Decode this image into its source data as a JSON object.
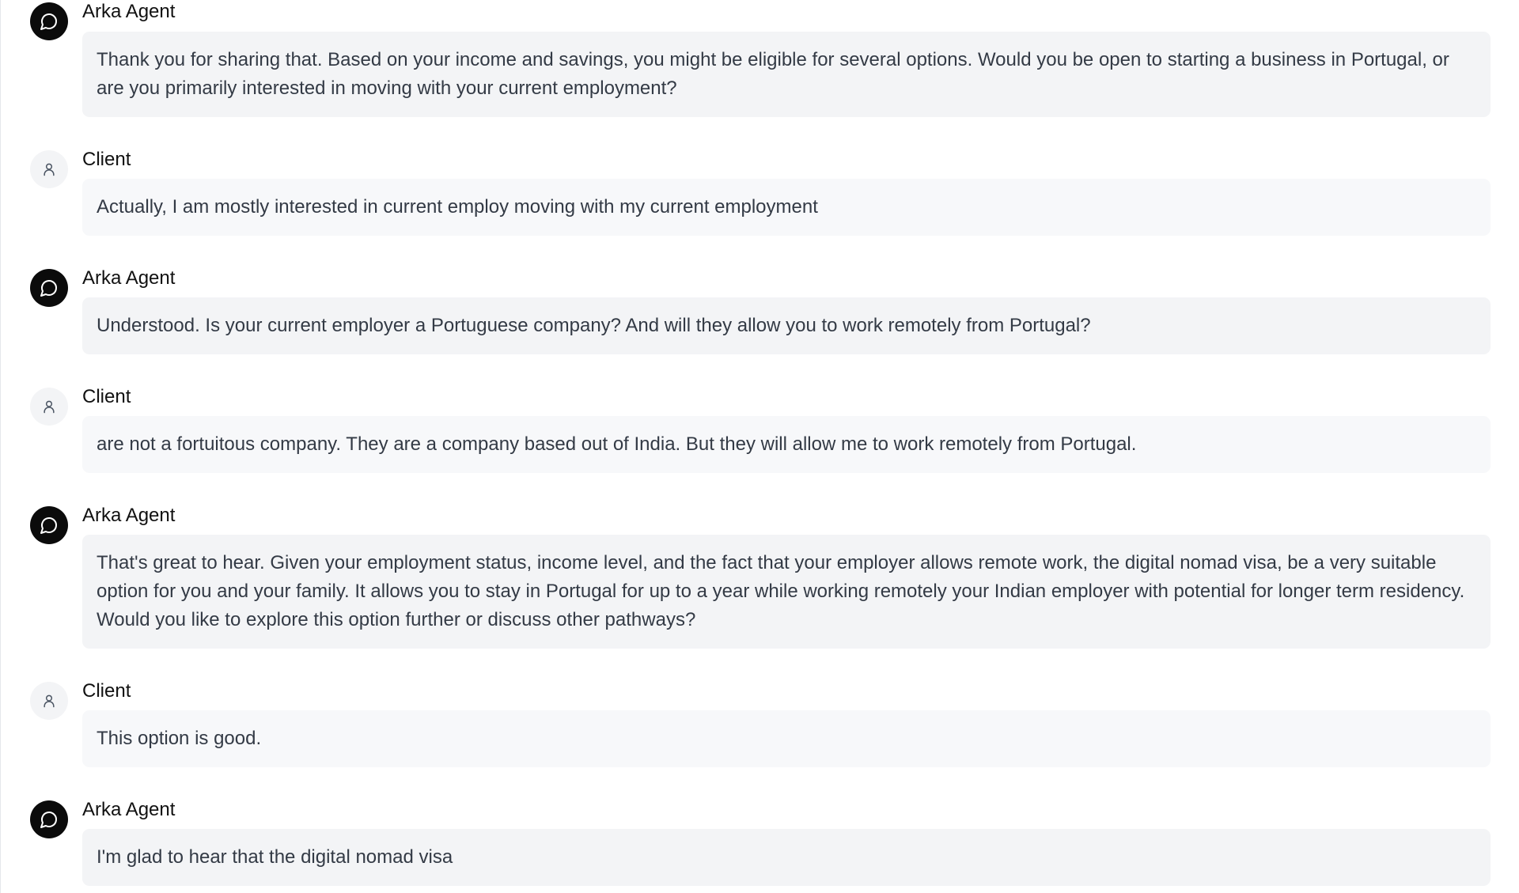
{
  "messages": [
    {
      "role": "agent",
      "speaker": "Arka Agent",
      "text": "Thank you for sharing that. Based on your income and savings, you might be eligible for several options. Would you be open to starting a business in Portugal, or are you primarily interested in moving with your current employment?"
    },
    {
      "role": "client",
      "speaker": "Client",
      "text": "Actually, I am mostly interested in current employ moving with my current employment"
    },
    {
      "role": "agent",
      "speaker": "Arka Agent",
      "text": "Understood. Is your current employer a Portuguese company? And will they allow you to work remotely from Portugal?"
    },
    {
      "role": "client",
      "speaker": "Client",
      "text": "are not a fortuitous company. They are a company based out of India. But they will allow me to work remotely from Portugal."
    },
    {
      "role": "agent",
      "speaker": "Arka Agent",
      "text": "That's great to hear. Given your employment status, income level, and the fact that your employer allows remote work, the digital nomad visa, be a very suitable option for you and your family. It allows you to stay in Portugal for up to a year while working remotely your Indian employer with potential for longer term residency. Would you like to explore this option further or discuss other pathways?"
    },
    {
      "role": "client",
      "speaker": "Client",
      "text": "This option is good."
    },
    {
      "role": "agent",
      "speaker": "Arka Agent",
      "text": "I'm glad to hear that the digital nomad visa"
    }
  ],
  "icons": {
    "agent": "chat-bubble-icon",
    "client": "user-icon"
  },
  "colors": {
    "agent_avatar": "#0b0b0b",
    "client_avatar": "#f3f4f6",
    "agent_bubble": "#f3f4f6",
    "client_bubble": "#f7f8fa"
  }
}
